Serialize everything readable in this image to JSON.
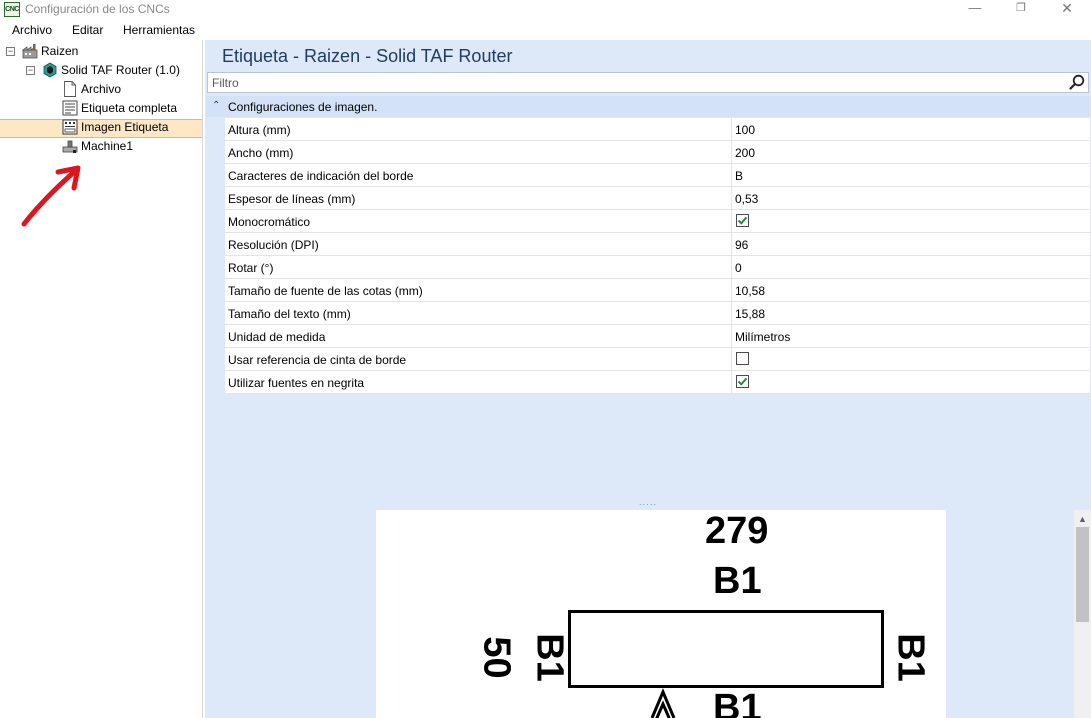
{
  "window": {
    "app_icon_text": "CNC",
    "title": "Configuración de los CNCs",
    "minimize": "—",
    "maximize": "❐",
    "close": "✕"
  },
  "menu": {
    "items": [
      "Archivo",
      "Editar",
      "Herramientas"
    ]
  },
  "tree": {
    "root": "Raizen",
    "machine": "Solid TAF Router (1.0)",
    "items": [
      "Archivo",
      "Etiqueta completa",
      "Imagen Etiqueta",
      "Machine1"
    ],
    "selected": "Imagen Etiqueta",
    "toggle_symbol": "−"
  },
  "content": {
    "title": "Etiqueta - Raizen - Solid TAF Router",
    "filter_placeholder": "Filtro",
    "group": {
      "toggle": "⌃",
      "label": "Configuraciones de imagen."
    },
    "properties": [
      {
        "name": "Altura (mm)",
        "value": "100"
      },
      {
        "name": "Ancho (mm)",
        "value": "200"
      },
      {
        "name": "Caracteres de indicación del borde",
        "value": "B"
      },
      {
        "name": "Espesor de líneas (mm)",
        "value": "0,53"
      },
      {
        "name": "Monocromático",
        "checked": true
      },
      {
        "name": "Resolución (DPI)",
        "value": "96"
      },
      {
        "name": "Rotar (°)",
        "value": "0"
      },
      {
        "name": "Tamaño de fuente de las cotas (mm)",
        "value": "10,58"
      },
      {
        "name": "Tamaño del texto (mm)",
        "value": "15,88"
      },
      {
        "name": "Unidad de medida",
        "value": "Milímetros"
      },
      {
        "name": "Usar referencia de cinta de borde",
        "checked": false
      },
      {
        "name": "Utilizar fuentes en negrita",
        "checked": true
      }
    ]
  },
  "preview": {
    "top_dimension": "279",
    "edge_top": "B1",
    "edge_left": "B1",
    "edge_right": "B1",
    "edge_bottom": "B1",
    "left_dimension": "50"
  },
  "colors": {
    "accent_title": "#1c3d6a",
    "panel_bg": "#dde9f8",
    "selection_bg": "#fde7c4",
    "annotation_red": "#e0141e",
    "check_green": "#2c8a3c"
  }
}
